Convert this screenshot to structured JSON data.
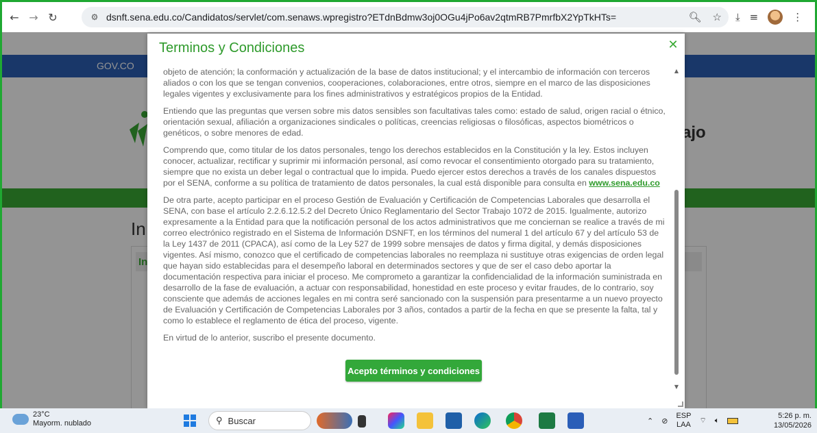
{
  "browser": {
    "url": "dsnft.sena.edu.co/Candidatos/servlet/com.senaws.wpregistro?ETdnBdmw3oj0OGu4jPo6av2qtmRB7PmrfbX2YpTkHTs="
  },
  "page": {
    "gov_label": "GOV.CO",
    "heading_partial": "In",
    "panel_head_partial": "Int",
    "trabajo_partial": "ajo"
  },
  "modal": {
    "title": "Terminos y Condiciones",
    "paragraphs": [
      "objeto de atención; la conformación y actualización de la base de datos institucional; y el intercambio de información con terceros aliados o con los que se tengan convenios, cooperaciones, colaboraciones, entre otros, siempre en el marco de las disposiciones legales vigentes y exclusivamente para los fines administrativos y estratégicos propios de la Entidad.",
      "Entiendo que las preguntas que versen sobre mis datos sensibles son facultativas tales como: estado de salud, origen racial o étnico, orientación sexual, afiliación a organizaciones sindicales o políticas, creencias religiosas o filosóficas, aspectos biométricos o genéticos, o sobre menores de edad.",
      "Comprendo que, como titular de los datos personales, tengo los derechos establecidos en la Constitución y la ley. Estos incluyen conocer, actualizar, rectificar y suprimir mi información personal, así como revocar el consentimiento otorgado para su tratamiento, siempre que no exista un deber legal o contractual que lo impida. Puedo ejercer estos derechos a través de los canales dispuestos por el SENA, conforme a su política de tratamiento de datos personales, la cual está disponible para consulta en",
      "De otra parte, acepto participar en el proceso Gestión de Evaluación y Certificación de Competencias Laborales que desarrolla el SENA, con base el artículo 2.2.6.12.5.2 del Decreto Único Reglamentario del Sector Trabajo 1072 de 2015. Igualmente, autorizo expresamente a la Entidad para que la notificación personal de los actos administrativos que me conciernan se realice a través de mi correo electrónico registrado en el Sistema de Información DSNFT, en los términos del numeral 1 del artículo 67 y del artículo 53 de la Ley 1437 de 2011 (CPACA), así como de la Ley 527 de 1999 sobre mensajes de datos y firma digital, y demás disposiciones vigentes. Así mismo, conozco que el certificado de competencias laborales no reemplaza ni sustituye otras exigencias de orden legal que hayan sido establecidas para el desempeño laboral en determinados sectores y que de ser el caso debo aportar la documentación respectiva para iniciar el proceso. Me comprometo a garantizar la confidencialidad de la información suministrada en desarrollo de la fase de evaluación, a actuar con responsabilidad, honestidad en este proceso y evitar fraudes, de lo contrario, soy consciente que además de acciones legales en mi contra seré sancionado con la suspensión para presentarme a un nuevo proyecto de Evaluación y Certificación de Competencias Laborales por 3 años, contados a partir de la fecha en que se presente la falta, tal y como lo establece el reglamento de ética del proceso, vigente.",
      "En virtud de lo anterior, suscribo el presente documento."
    ],
    "link_text": "www.sena.edu.co",
    "accept_label": "Acepto términos y condiciones",
    "close_glyph": "✕"
  },
  "taskbar": {
    "temperature": "23°C",
    "weather": "Mayorm. nublado",
    "search_label": "Buscar",
    "lang_line1": "ESP",
    "lang_line2": "LAA",
    "time": "5:26 p. m.",
    "date": "13/05/2026"
  },
  "colors": {
    "accent_green": "#33a83a",
    "gov_blue": "#2b5fb5",
    "frame_border": "#1fa832"
  }
}
